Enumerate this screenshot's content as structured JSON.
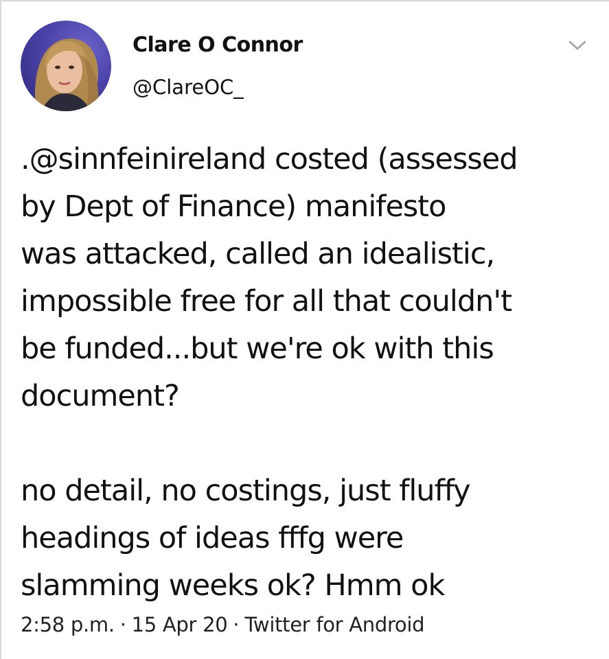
{
  "author": {
    "name": "Clare O Connor",
    "handle": "@ClareOC_",
    "avatar_icon": "profile-photo"
  },
  "tweet": {
    "paragraphs": [
      ".@sinnfeinireland costed  (assessed\nby Dept of Finance) manifesto\nwas attacked, called an idealistic,\nimpossible free for all that couldn't\nbe funded...but we're ok with this\ndocument?",
      "no detail, no costings, just fluffy\nheadings of ideas fffg were\nslamming weeks ok? Hmm ok"
    ]
  },
  "meta": {
    "time": "2:58 p.m.",
    "date": "15 Apr 20",
    "source": "Twitter for Android",
    "separator": "·"
  },
  "icons": {
    "menu": "chevron-down-icon"
  },
  "colors": {
    "text": "#111111",
    "chevron": "#9aa3ab",
    "avatar_bg": "#4a42a8"
  }
}
